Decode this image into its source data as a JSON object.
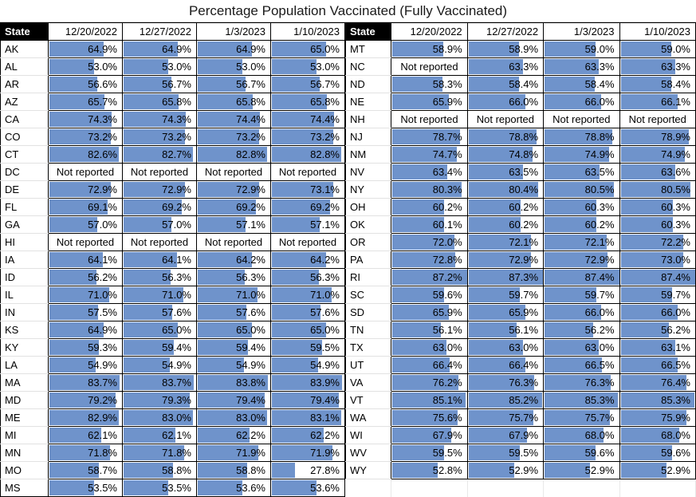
{
  "title": "Percentage Population Vaccinated (Fully Vaccinated)",
  "columns": {
    "state_label": "State",
    "dates": [
      "12/20/2022",
      "12/27/2022",
      "1/3/2023",
      "1/10/2023"
    ]
  },
  "not_reported_text": "Not reported",
  "colors": {
    "bar": "#6f93cb",
    "header_bg": "#000000",
    "header_fg": "#ffffff",
    "grid": "#000000"
  },
  "chart_data": {
    "type": "table",
    "title": "Percentage Population Vaccinated (Fully Vaccinated)",
    "xlabel": "",
    "ylabel": "",
    "bar_scale_max": 87.4,
    "categories": [
      "12/20/2022",
      "12/27/2022",
      "1/3/2023",
      "1/10/2023"
    ],
    "left_rows": [
      {
        "state": "AK",
        "values": [
          "64.9%",
          "64.9%",
          "64.9%",
          "65.0%"
        ],
        "nums": [
          64.9,
          64.9,
          64.9,
          65.0
        ]
      },
      {
        "state": "AL",
        "values": [
          "53.0%",
          "53.0%",
          "53.0%",
          "53.0%"
        ],
        "nums": [
          53.0,
          53.0,
          53.0,
          53.0
        ]
      },
      {
        "state": "AR",
        "values": [
          "56.6%",
          "56.7%",
          "56.7%",
          "56.7%"
        ],
        "nums": [
          56.6,
          56.7,
          56.7,
          56.7
        ]
      },
      {
        "state": "AZ",
        "values": [
          "65.7%",
          "65.8%",
          "65.8%",
          "65.8%"
        ],
        "nums": [
          65.7,
          65.8,
          65.8,
          65.8
        ]
      },
      {
        "state": "CA",
        "values": [
          "74.3%",
          "74.3%",
          "74.4%",
          "74.4%"
        ],
        "nums": [
          74.3,
          74.3,
          74.4,
          74.4
        ]
      },
      {
        "state": "CO",
        "values": [
          "73.2%",
          "73.2%",
          "73.2%",
          "73.2%"
        ],
        "nums": [
          73.2,
          73.2,
          73.2,
          73.2
        ]
      },
      {
        "state": "CT",
        "values": [
          "82.6%",
          "82.7%",
          "82.8%",
          "82.8%"
        ],
        "nums": [
          82.6,
          82.7,
          82.8,
          82.8
        ]
      },
      {
        "state": "DC",
        "values": [
          "Not reported",
          "Not reported",
          "Not reported",
          "Not reported"
        ],
        "nums": [
          null,
          null,
          null,
          null
        ]
      },
      {
        "state": "DE",
        "values": [
          "72.9%",
          "72.9%",
          "72.9%",
          "73.1%"
        ],
        "nums": [
          72.9,
          72.9,
          72.9,
          73.1
        ]
      },
      {
        "state": "FL",
        "values": [
          "69.1%",
          "69.2%",
          "69.2%",
          "69.2%"
        ],
        "nums": [
          69.1,
          69.2,
          69.2,
          69.2
        ]
      },
      {
        "state": "GA",
        "values": [
          "57.0%",
          "57.0%",
          "57.1%",
          "57.1%"
        ],
        "nums": [
          57.0,
          57.0,
          57.1,
          57.1
        ]
      },
      {
        "state": "HI",
        "values": [
          "Not reported",
          "Not reported",
          "Not reported",
          "Not reported"
        ],
        "nums": [
          null,
          null,
          null,
          null
        ]
      },
      {
        "state": "IA",
        "values": [
          "64.1%",
          "64.1%",
          "64.2%",
          "64.2%"
        ],
        "nums": [
          64.1,
          64.1,
          64.2,
          64.2
        ]
      },
      {
        "state": "ID",
        "values": [
          "56.2%",
          "56.3%",
          "56.3%",
          "56.3%"
        ],
        "nums": [
          56.2,
          56.3,
          56.3,
          56.3
        ]
      },
      {
        "state": "IL",
        "values": [
          "71.0%",
          "71.0%",
          "71.0%",
          "71.0%"
        ],
        "nums": [
          71.0,
          71.0,
          71.0,
          71.0
        ]
      },
      {
        "state": "IN",
        "values": [
          "57.5%",
          "57.6%",
          "57.6%",
          "57.6%"
        ],
        "nums": [
          57.5,
          57.6,
          57.6,
          57.6
        ]
      },
      {
        "state": "KS",
        "values": [
          "64.9%",
          "65.0%",
          "65.0%",
          "65.0%"
        ],
        "nums": [
          64.9,
          65.0,
          65.0,
          65.0
        ]
      },
      {
        "state": "KY",
        "values": [
          "59.3%",
          "59.4%",
          "59.4%",
          "59.5%"
        ],
        "nums": [
          59.3,
          59.4,
          59.4,
          59.5
        ]
      },
      {
        "state": "LA",
        "values": [
          "54.9%",
          "54.9%",
          "54.9%",
          "54.9%"
        ],
        "nums": [
          54.9,
          54.9,
          54.9,
          54.9
        ]
      },
      {
        "state": "MA",
        "values": [
          "83.7%",
          "83.7%",
          "83.8%",
          "83.9%"
        ],
        "nums": [
          83.7,
          83.7,
          83.8,
          83.9
        ]
      },
      {
        "state": "MD",
        "values": [
          "79.2%",
          "79.3%",
          "79.4%",
          "79.4%"
        ],
        "nums": [
          79.2,
          79.3,
          79.4,
          79.4
        ]
      },
      {
        "state": "ME",
        "values": [
          "82.9%",
          "83.0%",
          "83.0%",
          "83.1%"
        ],
        "nums": [
          82.9,
          83.0,
          83.0,
          83.1
        ]
      },
      {
        "state": "MI",
        "values": [
          "62.1%",
          "62.1%",
          "62.2%",
          "62.2%"
        ],
        "nums": [
          62.1,
          62.1,
          62.2,
          62.2
        ]
      },
      {
        "state": "MN",
        "values": [
          "71.8%",
          "71.8%",
          "71.9%",
          "71.9%"
        ],
        "nums": [
          71.8,
          71.8,
          71.9,
          71.9
        ]
      },
      {
        "state": "MO",
        "values": [
          "58.7%",
          "58.8%",
          "58.8%",
          "27.8%"
        ],
        "nums": [
          58.7,
          58.8,
          58.8,
          27.8
        ]
      },
      {
        "state": "MS",
        "values": [
          "53.5%",
          "53.5%",
          "53.6%",
          "53.6%"
        ],
        "nums": [
          53.5,
          53.5,
          53.6,
          53.6
        ]
      }
    ],
    "right_rows": [
      {
        "state": "MT",
        "values": [
          "58.9%",
          "58.9%",
          "59.0%",
          "59.0%"
        ],
        "nums": [
          58.9,
          58.9,
          59.0,
          59.0
        ]
      },
      {
        "state": "NC",
        "values": [
          "Not reported",
          "63.3%",
          "63.3%",
          "63.3%"
        ],
        "nums": [
          null,
          63.3,
          63.3,
          63.3
        ]
      },
      {
        "state": "ND",
        "values": [
          "58.3%",
          "58.4%",
          "58.4%",
          "58.4%"
        ],
        "nums": [
          58.3,
          58.4,
          58.4,
          58.4
        ]
      },
      {
        "state": "NE",
        "values": [
          "65.9%",
          "66.0%",
          "66.0%",
          "66.1%"
        ],
        "nums": [
          65.9,
          66.0,
          66.0,
          66.1
        ]
      },
      {
        "state": "NH",
        "values": [
          "Not reported",
          "Not reported",
          "Not reported",
          "Not reported"
        ],
        "nums": [
          null,
          null,
          null,
          null
        ]
      },
      {
        "state": "NJ",
        "values": [
          "78.7%",
          "78.8%",
          "78.8%",
          "78.9%"
        ],
        "nums": [
          78.7,
          78.8,
          78.8,
          78.9
        ]
      },
      {
        "state": "NM",
        "values": [
          "74.7%",
          "74.8%",
          "74.9%",
          "74.9%"
        ],
        "nums": [
          74.7,
          74.8,
          74.9,
          74.9
        ]
      },
      {
        "state": "NV",
        "values": [
          "63.4%",
          "63.5%",
          "63.5%",
          "63.6%"
        ],
        "nums": [
          63.4,
          63.5,
          63.5,
          63.6
        ]
      },
      {
        "state": "NY",
        "values": [
          "80.3%",
          "80.4%",
          "80.5%",
          "80.5%"
        ],
        "nums": [
          80.3,
          80.4,
          80.5,
          80.5
        ]
      },
      {
        "state": "OH",
        "values": [
          "60.2%",
          "60.2%",
          "60.3%",
          "60.3%"
        ],
        "nums": [
          60.2,
          60.2,
          60.3,
          60.3
        ]
      },
      {
        "state": "OK",
        "values": [
          "60.1%",
          "60.2%",
          "60.2%",
          "60.3%"
        ],
        "nums": [
          60.1,
          60.2,
          60.2,
          60.3
        ]
      },
      {
        "state": "OR",
        "values": [
          "72.0%",
          "72.1%",
          "72.1%",
          "72.2%"
        ],
        "nums": [
          72.0,
          72.1,
          72.1,
          72.2
        ]
      },
      {
        "state": "PA",
        "values": [
          "72.8%",
          "72.9%",
          "72.9%",
          "73.0%"
        ],
        "nums": [
          72.8,
          72.9,
          72.9,
          73.0
        ]
      },
      {
        "state": "RI",
        "values": [
          "87.2%",
          "87.3%",
          "87.4%",
          "87.4%"
        ],
        "nums": [
          87.2,
          87.3,
          87.4,
          87.4
        ]
      },
      {
        "state": "SC",
        "values": [
          "59.6%",
          "59.7%",
          "59.7%",
          "59.7%"
        ],
        "nums": [
          59.6,
          59.7,
          59.7,
          59.7
        ]
      },
      {
        "state": "SD",
        "values": [
          "65.9%",
          "65.9%",
          "66.0%",
          "66.0%"
        ],
        "nums": [
          65.9,
          65.9,
          66.0,
          66.0
        ]
      },
      {
        "state": "TN",
        "values": [
          "56.1%",
          "56.1%",
          "56.2%",
          "56.2%"
        ],
        "nums": [
          56.1,
          56.1,
          56.2,
          56.2
        ]
      },
      {
        "state": "TX",
        "values": [
          "63.0%",
          "63.0%",
          "63.0%",
          "63.1%"
        ],
        "nums": [
          63.0,
          63.0,
          63.0,
          63.1
        ]
      },
      {
        "state": "UT",
        "values": [
          "66.4%",
          "66.4%",
          "66.5%",
          "66.5%"
        ],
        "nums": [
          66.4,
          66.4,
          66.5,
          66.5
        ]
      },
      {
        "state": "VA",
        "values": [
          "76.2%",
          "76.3%",
          "76.3%",
          "76.4%"
        ],
        "nums": [
          76.2,
          76.3,
          76.3,
          76.4
        ]
      },
      {
        "state": "VT",
        "values": [
          "85.1%",
          "85.2%",
          "85.3%",
          "85.3%"
        ],
        "nums": [
          85.1,
          85.2,
          85.3,
          85.3
        ]
      },
      {
        "state": "WA",
        "values": [
          "75.6%",
          "75.7%",
          "75.7%",
          "75.9%"
        ],
        "nums": [
          75.6,
          75.7,
          75.7,
          75.9
        ]
      },
      {
        "state": "WI",
        "values": [
          "67.9%",
          "67.9%",
          "68.0%",
          "68.0%"
        ],
        "nums": [
          67.9,
          67.9,
          68.0,
          68.0
        ]
      },
      {
        "state": "WV",
        "values": [
          "59.5%",
          "59.5%",
          "59.6%",
          "59.6%"
        ],
        "nums": [
          59.5,
          59.5,
          59.6,
          59.6
        ]
      },
      {
        "state": "WY",
        "values": [
          "52.8%",
          "52.9%",
          "52.9%",
          "52.9%"
        ],
        "nums": [
          52.8,
          52.9,
          52.9,
          52.9
        ]
      },
      {
        "state": "",
        "values": [
          "",
          "",
          "",
          ""
        ],
        "nums": [
          null,
          null,
          null,
          null
        ]
      }
    ]
  }
}
